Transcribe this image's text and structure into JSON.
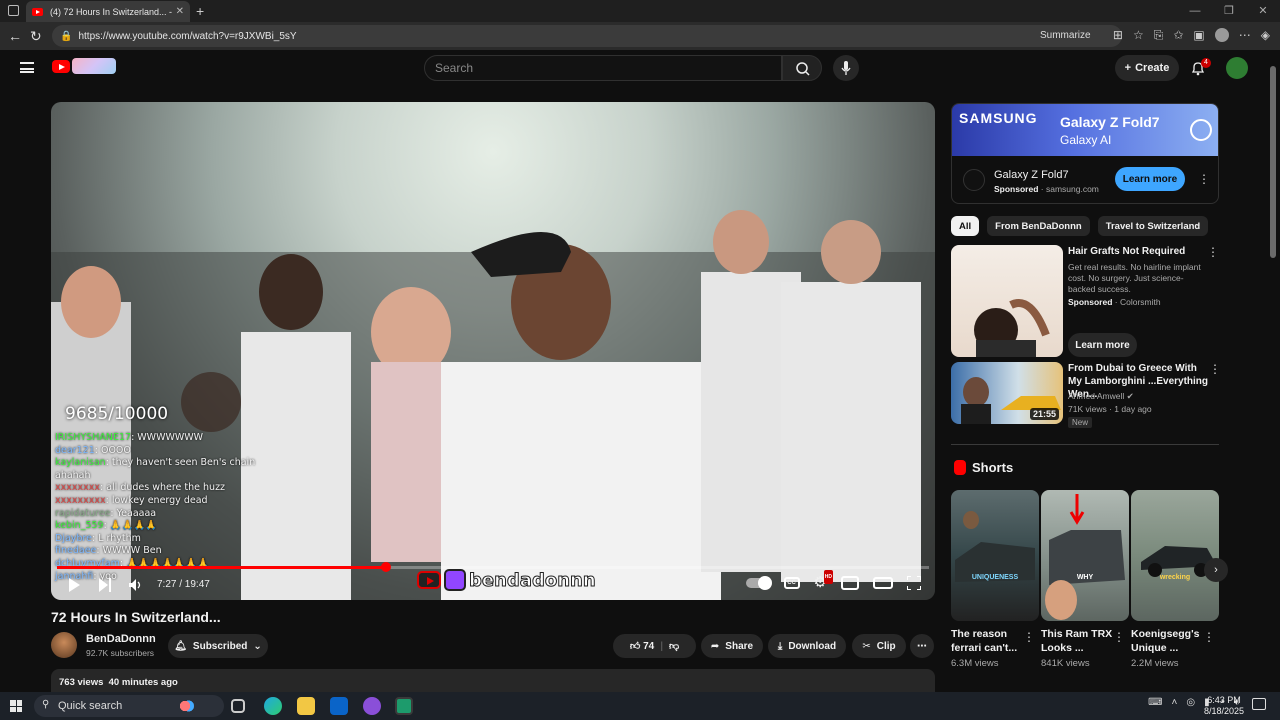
{
  "browser": {
    "tab_title": "(4) 72 Hours In Switzerland... - YouTube",
    "url": "https://www.youtube.com/watch?v=r9JXWBi_5sY",
    "summarize_label": "Summarize"
  },
  "yt_header": {
    "search_placeholder": "Search",
    "create_label": "Create",
    "notification_count": "4"
  },
  "player": {
    "sub_goal": "9685/10000",
    "chat": [
      {
        "user": "IRISHYSHANE17",
        "msg": ": WWWWWWW"
      },
      {
        "user": "dear121",
        "msg": ": OOOO"
      },
      {
        "user": "kaylanisan",
        "msg": ": they haven't seen Ben's chain ahahah"
      },
      {
        "user": "xxxxxxxx",
        "msg": ": all dudes where the huzz"
      },
      {
        "user": "xxxxxxxxx",
        "msg": ": lowkey energy dead"
      },
      {
        "user": "rapidaturee",
        "msg": ": Yeaaaaa"
      },
      {
        "user": "kebin_559",
        "msg": ": 🙏🙏🙏🙏"
      },
      {
        "user": "Djaybre",
        "msg": ": L rhythm"
      },
      {
        "user": "finedaee",
        "msg": ": WWWW Ben"
      },
      {
        "user": "dchluvmyfam",
        "msg": ": 🙏🙏🙏🙏🙏🙏🙏"
      },
      {
        "user": "jannahfi",
        "msg": ": yoo"
      }
    ],
    "overlay_name": "bendadonnn",
    "time_display": "7:27 / 19:47",
    "progress_fraction": 0.377
  },
  "video": {
    "title": "72 Hours In Switzerland...",
    "channel_name": "BenDaDonnn",
    "subscribers": "92.7K subscribers",
    "subscribed_label": "Subscribed",
    "likes": "74",
    "share_label": "Share",
    "download_label": "Download",
    "clip_label": "Clip",
    "description_summary": "763 views  40 minutes ago"
  },
  "sidebar": {
    "ad": {
      "brand": "SAMSUNG",
      "product": "Galaxy Z Fold7",
      "tagline": "Galaxy AI",
      "title": "Galaxy Z Fold7",
      "sponsored": "Sponsored",
      "domain": "· samsung.com",
      "cta": "Learn more"
    },
    "chips": [
      "All",
      "From BenDaDonnn",
      "Travel to Switzerland"
    ],
    "rec_ad": {
      "title": "Hair Grafts Not Required",
      "desc": "Get real results. No hairline implant cost. No surgery. Just science-backed success.",
      "sponsored": "Sponsored",
      "advertiser": "· Colorsmith",
      "cta": "Learn more"
    },
    "rec_video": {
      "title": "From Dubai to Greece With My Lamborghini ...Everything Wen...",
      "channel": "Ahmed Amwell",
      "meta": "71K views · 1 day ago",
      "badge": "New",
      "duration": "21:55"
    },
    "shorts_heading": "Shorts",
    "shorts": [
      {
        "title": "The reason ferrari can't...",
        "views": "6.3M views",
        "overlay": "UNIQUENESS"
      },
      {
        "title": "This Ram TRX Looks ...",
        "views": "841K views",
        "overlay": "WHY"
      },
      {
        "title": "Koenigsegg's Unique ...",
        "views": "2.2M views",
        "overlay": "wrecking"
      }
    ]
  },
  "taskbar": {
    "search_label": "Quick search",
    "time": "6:43 PM",
    "date": "8/18/2025"
  },
  "colors": {
    "youtube_red": "#ff0000",
    "accent_blue": "#3ea6ff",
    "twitch_purple": "#9146ff"
  }
}
